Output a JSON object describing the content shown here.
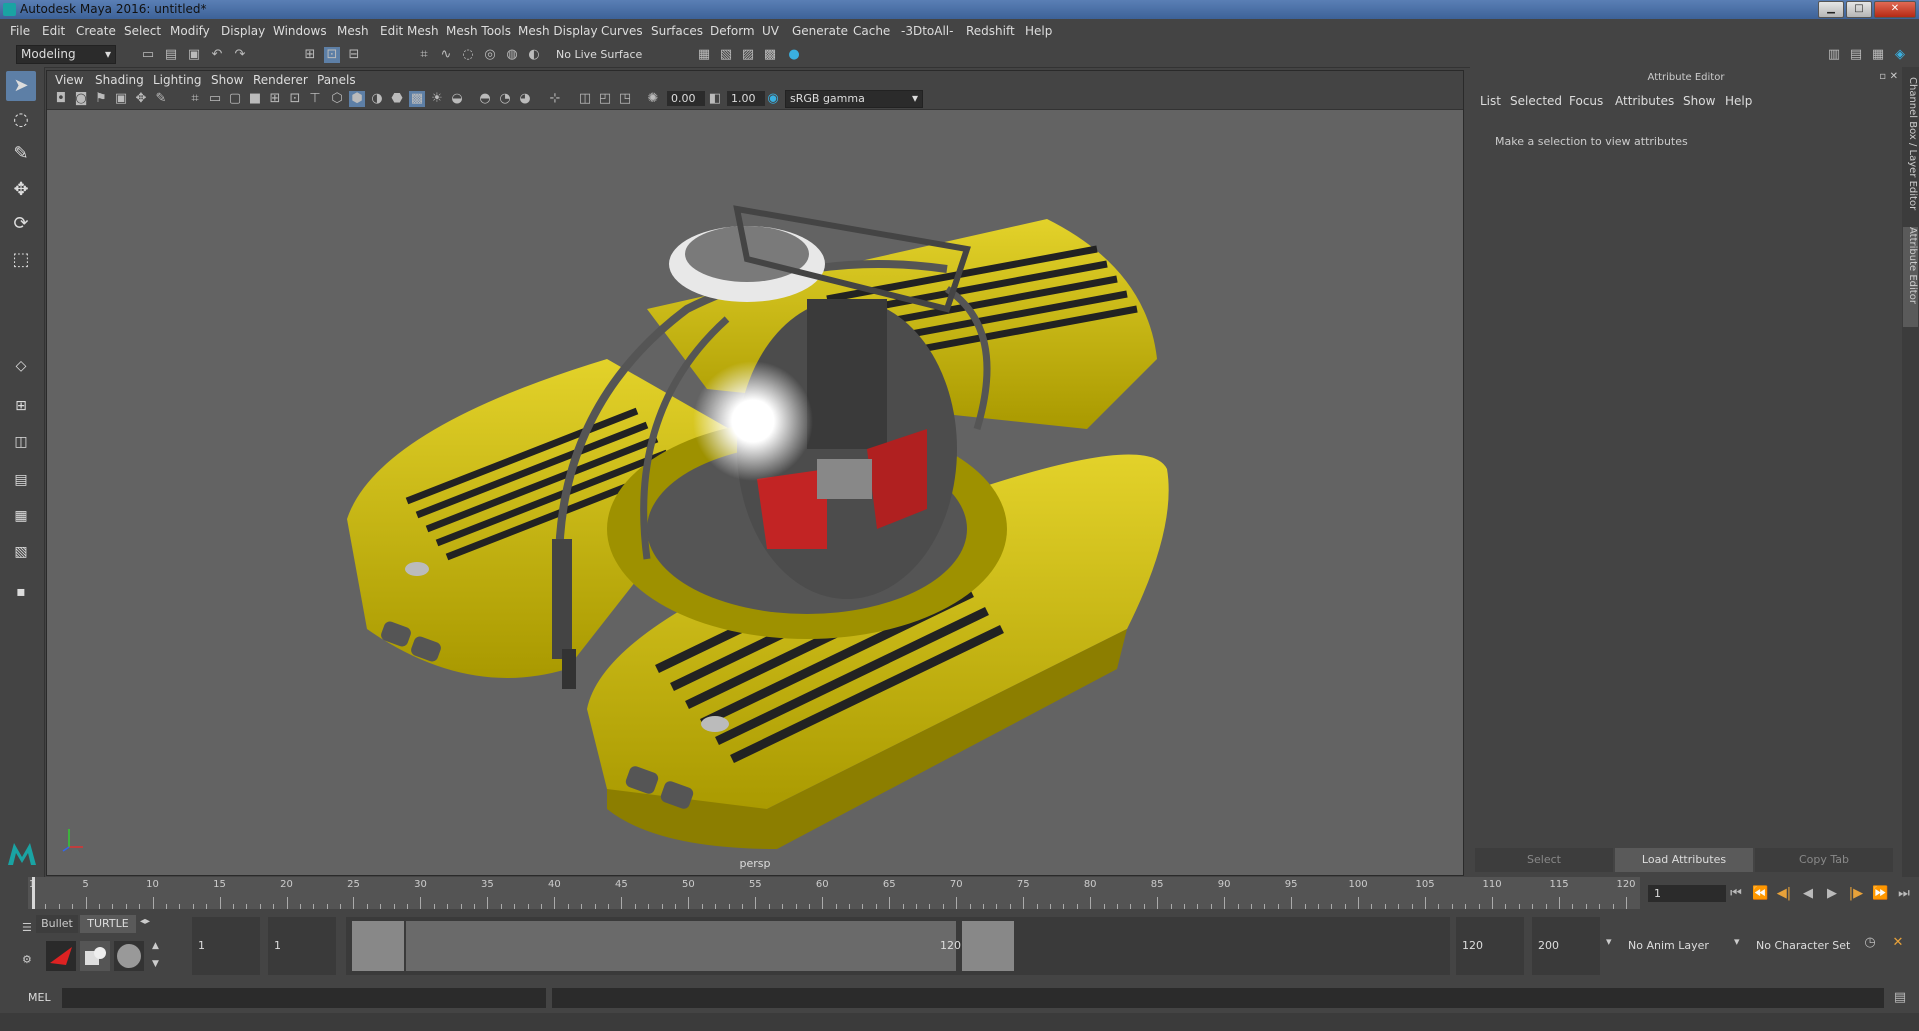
{
  "window": {
    "title": "Autodesk Maya 2016: untitled*"
  },
  "menubar": [
    "File",
    "Edit",
    "Create",
    "Select",
    "Modify",
    "Display",
    "Windows",
    "Mesh",
    "Edit Mesh",
    "Mesh Tools",
    "Mesh Display",
    "Curves",
    "Surfaces",
    "Deform",
    "UV",
    "Generate",
    "Cache",
    "-3DtoAll-",
    "Redshift",
    "Help"
  ],
  "status": {
    "mode": "Modeling",
    "live_surface": "No Live Surface"
  },
  "viewport": {
    "menus": [
      "View",
      "Shading",
      "Lighting",
      "Show",
      "Renderer",
      "Panels"
    ],
    "exposure": "0.00",
    "gamma": "1.00",
    "colorspace": "sRGB gamma",
    "camera": "persp"
  },
  "attribute_editor": {
    "title": "Attribute Editor",
    "menus": [
      "List",
      "Selected",
      "Focus",
      "Attributes",
      "Show",
      "Help"
    ],
    "message": "Make a selection to view attributes",
    "buttons": [
      "Select",
      "Load Attributes",
      "Copy Tab"
    ]
  },
  "side_tabs": {
    "channel_box": "Channel Box / Layer Editor",
    "attribute_editor": "Attribute Editor"
  },
  "timeline": {
    "ticks": [
      "1",
      "5",
      "10",
      "15",
      "20",
      "25",
      "30",
      "35",
      "40",
      "45",
      "50",
      "55",
      "60",
      "65",
      "70",
      "75",
      "80",
      "85",
      "90",
      "95",
      "100",
      "105",
      "110",
      "115",
      "120"
    ],
    "current_frame": "1"
  },
  "range": {
    "shelf_tabs": [
      "Bullet",
      "TURTLE"
    ],
    "start": "1",
    "playback_start": "1",
    "range_start_label": "1",
    "range_end_label": "120",
    "playback_end": "120",
    "end": "200",
    "anim_layer": "No Anim Layer",
    "character_set": "No Character Set"
  },
  "command": {
    "label": "MEL"
  },
  "colors": {
    "accent": "#5d7fa6",
    "viewport_bg": "#636363",
    "vehicle": "#d4c20e"
  }
}
